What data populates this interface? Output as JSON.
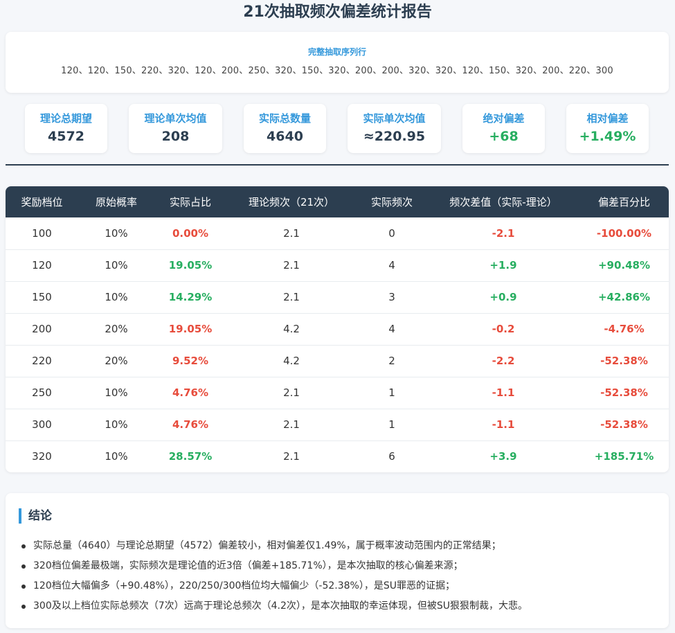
{
  "title": "21次抽取频次偏差统计报告",
  "sequence": {
    "label": "完整抽取序列行",
    "values": "120、120、150、220、320、120、200、250、320、150、320、200、200、320、320、120、150、320、200、220、300"
  },
  "stats": [
    {
      "label": "理论总期望",
      "value": "4572",
      "color": "default"
    },
    {
      "label": "理论单次均值",
      "value": "208",
      "color": "default"
    },
    {
      "label": "实际总数量",
      "value": "4640",
      "color": "default"
    },
    {
      "label": "实际单次均值",
      "value": "≈220.95",
      "color": "default"
    },
    {
      "label": "绝对偏差",
      "value": "+68",
      "color": "green"
    },
    {
      "label": "相对偏差",
      "value": "+1.49%",
      "color": "green"
    }
  ],
  "table": {
    "headers": [
      "奖励档位",
      "原始概率",
      "实际占比",
      "理论频次（21次）",
      "实际频次",
      "频次差值（实际-理论）",
      "偏差百分比"
    ],
    "rows": [
      {
        "tier": "100",
        "prob": "10%",
        "share": "0.00%",
        "share_color": "red",
        "theory": "2.1",
        "actual": "0",
        "diff": "-2.1",
        "pct": "-100.00%",
        "diff_color": "red"
      },
      {
        "tier": "120",
        "prob": "10%",
        "share": "19.05%",
        "share_color": "green",
        "theory": "2.1",
        "actual": "4",
        "diff": "+1.9",
        "pct": "+90.48%",
        "diff_color": "green"
      },
      {
        "tier": "150",
        "prob": "10%",
        "share": "14.29%",
        "share_color": "green",
        "theory": "2.1",
        "actual": "3",
        "diff": "+0.9",
        "pct": "+42.86%",
        "diff_color": "green"
      },
      {
        "tier": "200",
        "prob": "20%",
        "share": "19.05%",
        "share_color": "red",
        "theory": "4.2",
        "actual": "4",
        "diff": "-0.2",
        "pct": "-4.76%",
        "diff_color": "red"
      },
      {
        "tier": "220",
        "prob": "20%",
        "share": "9.52%",
        "share_color": "red",
        "theory": "4.2",
        "actual": "2",
        "diff": "-2.2",
        "pct": "-52.38%",
        "diff_color": "red"
      },
      {
        "tier": "250",
        "prob": "10%",
        "share": "4.76%",
        "share_color": "red",
        "theory": "2.1",
        "actual": "1",
        "diff": "-1.1",
        "pct": "-52.38%",
        "diff_color": "red"
      },
      {
        "tier": "300",
        "prob": "10%",
        "share": "4.76%",
        "share_color": "red",
        "theory": "2.1",
        "actual": "1",
        "diff": "-1.1",
        "pct": "-52.38%",
        "diff_color": "red"
      },
      {
        "tier": "320",
        "prob": "10%",
        "share": "28.57%",
        "share_color": "green",
        "theory": "2.1",
        "actual": "6",
        "diff": "+3.9",
        "pct": "+185.71%",
        "diff_color": "green"
      }
    ]
  },
  "conclusion": {
    "title": "结论",
    "items": [
      "实际总量（4640）与理论总期望（4572）偏差较小，相对偏差仅1.49%，属于概率波动范围内的正常结果；",
      "320档位偏差最极端，实际频次是理论值的近3倍（偏差+185.71%），是本次抽取的核心偏差来源；",
      "120档位大幅偏多（+90.48%），220/250/300档位均大幅偏少（-52.38%），是SU罪恶的证据；",
      "300及以上档位实际总频次（7次）远高于理论总频次（4.2次），是本次抽取的幸运体现，但被SU狠狠制裁，大悲。"
    ]
  }
}
